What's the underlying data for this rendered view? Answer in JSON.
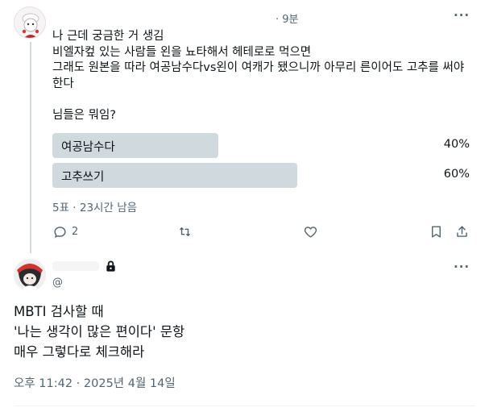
{
  "tweet1": {
    "time_ago": "· 9분",
    "lines": [
      "나 근데 궁금한 거 생김",
      "비엘자컾 있는 사람들 왼을 뇨타해서 헤테로로 먹으면",
      "그래도 원본을 따라 여공남수다vs왼이 여캐가 됐으니까 아무리 른이어도 고추를 써야",
      "한다",
      "",
      "님들은 뭐임?"
    ],
    "poll": {
      "options": [
        {
          "label": "여공남수다",
          "percent_text": "40%",
          "percent": 40
        },
        {
          "label": "고추쓰기",
          "percent_text": "60%",
          "percent": 60
        }
      ],
      "meta": "5표 · 23시간 남음"
    },
    "actions": {
      "reply_count": "2"
    }
  },
  "tweet2": {
    "handle": "@",
    "lines": [
      "MBTI 검사할 때",
      "'나는 생각이 많은 편이다' 문항",
      "매우 그렇다로 체크해라"
    ],
    "timestamp": "오후 11:42 · 2025년 4월 14일"
  },
  "colors": {
    "poll_bar": "#cfd9de",
    "secondary_text": "#536471",
    "primary_text": "#0f1419"
  }
}
